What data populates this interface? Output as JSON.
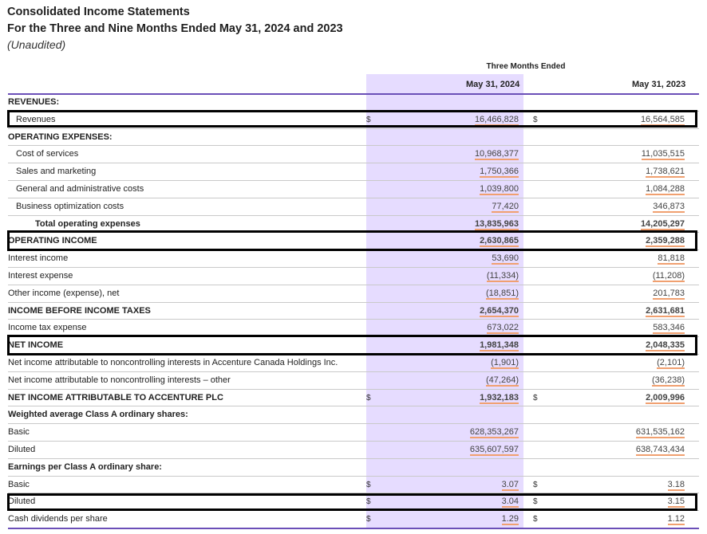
{
  "header": {
    "title_line1": "Consolidated Income Statements",
    "title_line2": "For the Three and Nine Months Ended May 31, 2024 and 2023",
    "subtitle": "(Unaudited)"
  },
  "table": {
    "period_header": "Three Months Ended",
    "col1": "May 31, 2024",
    "col2": "May 31, 2023",
    "currency_symbol": "$",
    "rows": [
      {
        "label": "REVENUES:",
        "v1": "",
        "v2": ""
      },
      {
        "label": "Revenues",
        "v1": "16,466,828",
        "v2": "16,564,585"
      },
      {
        "label": "OPERATING EXPENSES:",
        "v1": "",
        "v2": ""
      },
      {
        "label": "Cost of services",
        "v1": "10,968,377",
        "v2": "11,035,515"
      },
      {
        "label": "Sales and marketing",
        "v1": "1,750,366",
        "v2": "1,738,621"
      },
      {
        "label": "General and administrative costs",
        "v1": "1,039,800",
        "v2": "1,084,288"
      },
      {
        "label": "Business optimization costs",
        "v1": "77,420",
        "v2": "346,873"
      },
      {
        "label": "Total operating expenses",
        "v1": "13,835,963",
        "v2": "14,205,297"
      },
      {
        "label": "OPERATING INCOME",
        "v1": "2,630,865",
        "v2": "2,359,288"
      },
      {
        "label": "Interest income",
        "v1": "53,690",
        "v2": "81,818"
      },
      {
        "label": "Interest expense",
        "v1": "(11,334)",
        "v2": "(11,208)"
      },
      {
        "label": "Other income (expense), net",
        "v1": "(18,851)",
        "v2": "201,783"
      },
      {
        "label": "INCOME BEFORE INCOME TAXES",
        "v1": "2,654,370",
        "v2": "2,631,681"
      },
      {
        "label": "Income tax expense",
        "v1": "673,022",
        "v2": "583,346"
      },
      {
        "label": "NET INCOME",
        "v1": "1,981,348",
        "v2": "2,048,335"
      },
      {
        "label": "Net income attributable to noncontrolling interests in Accenture Canada Holdings Inc.",
        "v1": "(1,901)",
        "v2": "(2,101)"
      },
      {
        "label": "Net income attributable to noncontrolling interests – other",
        "v1": "(47,264)",
        "v2": "(36,238)"
      },
      {
        "label": "NET INCOME ATTRIBUTABLE TO ACCENTURE PLC",
        "v1": "1,932,183",
        "v2": "2,009,996"
      },
      {
        "label": "Weighted average Class A ordinary shares:",
        "v1": "",
        "v2": ""
      },
      {
        "label": "Basic",
        "v1": "628,353,267",
        "v2": "631,535,162"
      },
      {
        "label": "Diluted",
        "v1": "635,607,597",
        "v2": "638,743,434"
      },
      {
        "label": "Earnings per Class A ordinary share:",
        "v1": "",
        "v2": ""
      },
      {
        "label": "Basic",
        "v1": "3.07",
        "v2": "3.18"
      },
      {
        "label": "Diluted",
        "v1": "3.04",
        "v2": "3.15"
      },
      {
        "label": "Cash dividends per share",
        "v1": "1.29",
        "v2": "1.12"
      }
    ]
  }
}
